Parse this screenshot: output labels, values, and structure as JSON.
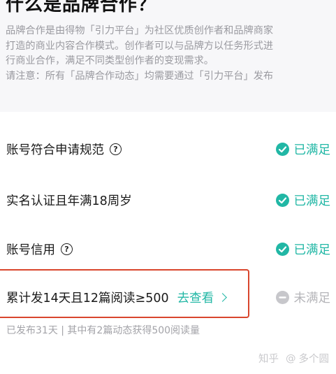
{
  "header": {
    "title": "什么是品牌合作？",
    "description_lines": [
      "品牌合作是由得物「引力平台」为社区优质创作者和品牌商家",
      "打造的商业内容合作模式。创作者可以与品牌方以任务形式进",
      "行商业合作，满足不同类型创作者的变现需求。",
      "请注意：所有「品牌合作动态」均需要通过「引力平台」发布"
    ]
  },
  "requirements": [
    {
      "label": "账号符合申请规范",
      "has_help": true,
      "status": "已满足",
      "status_icon": "check-circle-icon",
      "met": true
    },
    {
      "label": "实名认证且年满18周岁",
      "has_help": false,
      "status": "已满足",
      "status_icon": "check-circle-icon",
      "met": true
    },
    {
      "label": "账号信用",
      "has_help": true,
      "status": "已满足",
      "status_icon": "check-circle-icon",
      "met": true
    },
    {
      "label": "累计发14天且12篇阅读≥500",
      "has_help": false,
      "status": "未满足",
      "status_icon": "minus-circle-icon",
      "met": false,
      "link_text": "去查看"
    }
  ],
  "progress_note": "已发布31天 | 其中有2篇动态获得500阅读量",
  "watermark": {
    "site": "知乎",
    "at": "@",
    "author": "多个圆"
  },
  "colors": {
    "accent": "#21b7a5",
    "unmet": "#b5b5b9",
    "highlight_border": "#d9462d",
    "panel_bg": "#f7f7f9"
  }
}
